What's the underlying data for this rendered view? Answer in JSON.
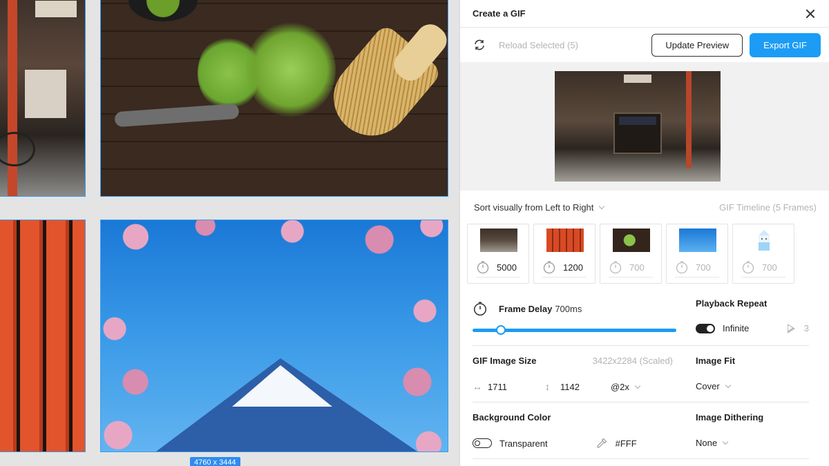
{
  "canvas": {
    "size_badge": "4760 x 3444"
  },
  "panel": {
    "title": "Create a GIF",
    "reload_label": "Reload Selected (5)",
    "update_preview_label": "Update Preview",
    "export_label": "Export GIF",
    "sort_label": "Sort visually from Left to Right",
    "timeline_label": "GIF Timeline (5 Frames)",
    "frames": [
      {
        "ms": "5000"
      },
      {
        "ms": "1200"
      },
      {
        "ms": "700"
      },
      {
        "ms": "700"
      },
      {
        "ms": "700"
      }
    ],
    "frame_delay": {
      "label": "Frame Delay",
      "value": "700ms",
      "slider_fraction": 0.14
    },
    "playback": {
      "label": "Playback Repeat",
      "mode": "Infinite",
      "count": "3"
    },
    "image_size": {
      "label": "GIF Image Size",
      "scaled": "3422x2284 (Scaled)",
      "width": "1711",
      "height": "1142",
      "scale": "@2x"
    },
    "image_fit": {
      "label": "Image Fit",
      "value": "Cover"
    },
    "background": {
      "label": "Background Color",
      "mode": "Transparent",
      "color": "#FFF"
    },
    "dithering": {
      "label": "Image Dithering",
      "value": "None"
    }
  },
  "colors": {
    "accent": "#1c9cf5",
    "selection": "#3a9cf0"
  }
}
